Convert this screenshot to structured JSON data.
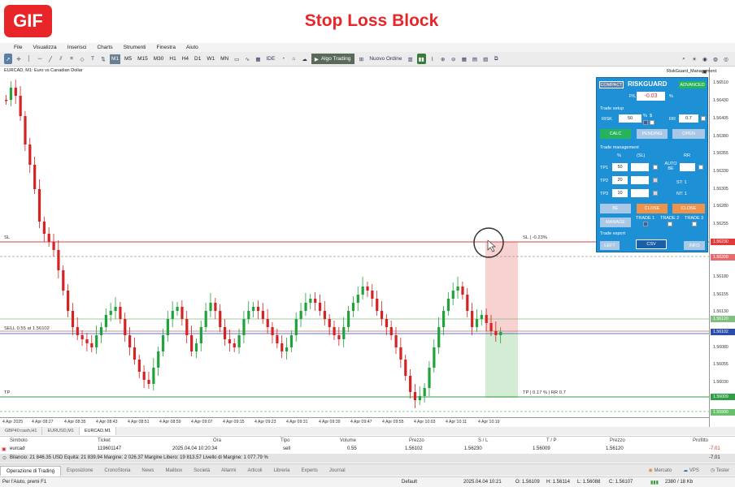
{
  "banner": {
    "badge": "GIF",
    "title": "Stop Loss Block"
  },
  "menu": [
    "File",
    "Visualizza",
    "Inserisci",
    "Charts",
    "Strumenti",
    "Finestra",
    "Aiuto"
  ],
  "toolbar": {
    "timeframes": [
      "M1",
      "M5",
      "M15",
      "M30",
      "H1",
      "H4",
      "D1",
      "W1",
      "MN"
    ],
    "ide": "IDE",
    "algo": "Algo Trading",
    "new_order": "Nuovo Ordine"
  },
  "chart": {
    "title": "EURCAD, M1:  Euro vs Canadian Dollar",
    "sl_label": "SL",
    "sl_info": "SL | -0.23%",
    "sell_label": "SELL 0.55 at 1.56102",
    "tp_label": "TP",
    "tp_info": "TP | 0.17 % | RR 0.7"
  },
  "price_scale": [
    "1.56510",
    "1.56430",
    "1.56405",
    "1.56380",
    "1.56355",
    "1.56330",
    "1.56305",
    "1.56280",
    "1.56255",
    "1.56180",
    "1.56155",
    "1.56130",
    "1.56080",
    "1.56055",
    "1.56030",
    "1.56005"
  ],
  "price_boxes": {
    "sl": "1.56230",
    "ask": "1.56209",
    "bid": "1.56120",
    "cur": "1.56102",
    "tp": "1.56009",
    "low": "1.55990"
  },
  "time_axis": [
    "4 Apr 2025",
    "4 Apr 08:27",
    "4 Apr 08:35",
    "4 Apr 08:43",
    "4 Apr 08:51",
    "4 Apr 08:59",
    "4 Apr 09:07",
    "4 Apr 09:15",
    "4 Apr 09:23",
    "4 Apr 09:31",
    "4 Apr 09:39",
    "4 Apr 09:47",
    "4 Apr 09:55",
    "4 Apr 10:03",
    "4 Apr 10:11",
    "4 Apr 10:19"
  ],
  "chart_tabs": [
    "GBP40:cash,H1",
    "EURUSD,M1",
    "EURCAD,M1"
  ],
  "panel": {
    "window_title": "RiskGuard_Management",
    "btn_left": "COMPACT",
    "brand": "RISKGUARD",
    "btn_right": "ADVANCED",
    "pl_label": "P/L",
    "pl_value": "-0.03",
    "pl_unit": "%",
    "trade_setup": "Trade setup",
    "risk_label": "RISK",
    "risk_value": "50",
    "pct": "%",
    "dollar": "$",
    "rr_label": "RR",
    "rr_value": "0.7",
    "calc": "CALC",
    "pending": "PENDING",
    "open": "OPEN",
    "trade_mgmt": "Trade management",
    "col_pct": "%",
    "col_sl": "(SL)",
    "col_rr": "RR",
    "tp1": "TP1",
    "tp1_v": "50",
    "tp2": "TP2",
    "tp2_v": "20",
    "tp3": "TP3",
    "tp3_v": "10",
    "auto_be": "AUTO BE",
    "st": "ST: 1",
    "nt": "NT: 1",
    "be": "BE",
    "close_all": "CLOSE",
    "close2": "CLOSE",
    "manage": "MANAGE",
    "trade1": "TRADE 1",
    "trade2": "TRADE 2",
    "trade3": "TRADE 3",
    "trade_export": "Trade export",
    "left": "LEFT",
    "csv": "CSV",
    "info": "INFO"
  },
  "table": {
    "headers": [
      "Simbolo",
      "Ticket",
      "Ora",
      "Tipo",
      "Volume",
      "Prezzo",
      "S / L",
      "T / P",
      "Prezzo",
      "Profitto"
    ],
    "row": [
      "eurcad",
      "119601147",
      "2025.04.04 10:20:34",
      "sell",
      "0.55",
      "1.56102",
      "1.56230",
      "1.56009",
      "1.56120",
      "-7.01"
    ],
    "balance": "Bilancio: 21 846.35 USD  Equità: 21 839.94  Margine: 2 026.37  Margine Libero: 19 813.57  Livello di Margine: 1 077.79 %",
    "balance_profit": "-7.01"
  },
  "bottom_tabs": [
    "Operazione di Trading",
    "Esposizione",
    "CronoStoria",
    "News",
    "Mailbox",
    "Società",
    "Allarmi",
    "Articoli",
    "Libreria",
    "Experts",
    "Journal"
  ],
  "bottom_right": {
    "market": "Mercato",
    "vps": "VPS",
    "tester": "Tester"
  },
  "status": {
    "help": "Per l'Aiuto, premi F1",
    "profile": "Default",
    "time": "2025.04.04 10:21",
    "o": "O: 1.56109",
    "h": "H: 1.56114",
    "l": "L: 1.56088",
    "c": "C: 1.56107",
    "net": "2380 / 18 Kb"
  },
  "chart_data": {
    "type": "candlestick",
    "symbol": "EURCAD",
    "timeframe": "M1",
    "levels": {
      "sl": 1.5623,
      "entry": 1.56102,
      "tp": 1.56009
    }
  }
}
